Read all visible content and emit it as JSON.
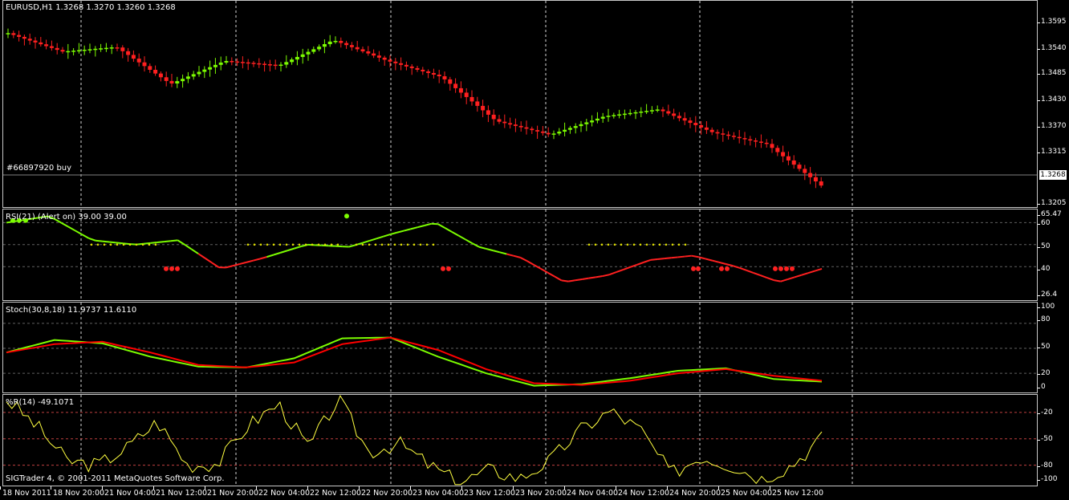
{
  "price_pane": {
    "header": "EURUSD,H1  1.3268 1.3270 1.3260 1.3268",
    "order_label": "#66897920 buy",
    "current_price": "1.3268",
    "axis_ticks": [
      "1.3595",
      "1.3540",
      "1.3485",
      "1.3430",
      "1.3370",
      "1.3315",
      "1.3260",
      "1.3205"
    ]
  },
  "rsi_pane": {
    "header": "RSI(21) (Alert on) 39.00 39.00",
    "axis_ticks": [
      "65.47",
      "60",
      "50",
      "40",
      "26.4"
    ]
  },
  "stoch_pane": {
    "header": "Stoch(30,8,18) 11.9737 11.6110",
    "axis_ticks": [
      "100",
      "80",
      "50",
      "20",
      "0"
    ]
  },
  "wpr_pane": {
    "header": "%R(14) -49.1071",
    "copyright": "SIGTrader 4, © 2001-2011 MetaQuotes Software Corp.",
    "axis_ticks": [
      "-20",
      "-50",
      "-80",
      "-100"
    ]
  },
  "time_axis": [
    "18 Nov 2011",
    "18 Nov 20:00",
    "21 Nov 04:00",
    "21 Nov 12:00",
    "21 Nov 20:00",
    "22 Nov 04:00",
    "22 Nov 12:00",
    "22 Nov 20:00",
    "23 Nov 04:00",
    "23 Nov 12:00",
    "23 Nov 20:00",
    "24 Nov 04:00",
    "24 Nov 12:00",
    "24 Nov 20:00",
    "25 Nov 04:00",
    "25 Nov 12:00"
  ],
  "colors": {
    "bull": "#7cfc00",
    "bear": "#ff2020",
    "signal": "#ff0000",
    "grid": "#ffffff",
    "level": "#c04040",
    "wpr": "#ffff40",
    "dots": "#e0e000"
  },
  "chart_data": [
    {
      "type": "line",
      "name": "price",
      "title": "EURUSD,H1",
      "x": [
        "18 Nov 2011",
        "18 Nov 20:00",
        "21 Nov 04:00",
        "21 Nov 12:00",
        "21 Nov 20:00",
        "22 Nov 04:00",
        "22 Nov 12:00",
        "22 Nov 20:00",
        "23 Nov 04:00",
        "23 Nov 12:00",
        "23 Nov 20:00",
        "24 Nov 04:00",
        "24 Nov 12:00",
        "24 Nov 20:00",
        "25 Nov 04:00",
        "25 Nov 12:00"
      ],
      "series": [
        {
          "values": [
            1.356,
            1.352,
            1.353,
            1.345,
            1.35,
            1.349,
            1.3545,
            1.35,
            1.3465,
            1.337,
            1.334,
            1.338,
            1.3395,
            1.3345,
            1.332,
            1.323
          ]
        }
      ],
      "ylim": [
        1.318,
        1.363
      ]
    },
    {
      "type": "line",
      "name": "rsi",
      "title": "RSI(21) (Alert on) 39.00 39.00",
      "series": [
        {
          "values": [
            60,
            63,
            52,
            50,
            52,
            39,
            44,
            50,
            49,
            55,
            60,
            49,
            44,
            33,
            36,
            43,
            45,
            40,
            33,
            39
          ]
        }
      ],
      "ylim": [
        24,
        66
      ]
    },
    {
      "type": "line",
      "name": "stoch",
      "title": "Stoch(30,8,18) 11.9737 11.6110",
      "series": [
        {
          "values": [
            45,
            60,
            56,
            40,
            28,
            27,
            38,
            62,
            63,
            40,
            20,
            5,
            7,
            14,
            23,
            26,
            13,
            10
          ]
        },
        {
          "values": [
            45,
            55,
            58,
            45,
            30,
            27,
            33,
            55,
            63,
            48,
            25,
            8,
            6,
            11,
            20,
            25,
            17,
            11
          ]
        }
      ],
      "ylim": [
        -5,
        105
      ]
    },
    {
      "type": "line",
      "name": "wpr",
      "title": "%R(14) -49.1071",
      "series": [
        {
          "values": [
            -5,
            -35,
            -75,
            -80,
            -60,
            -30,
            -80,
            -78,
            -35,
            -10,
            -60,
            -5,
            -65,
            -55,
            -80,
            -100,
            -85,
            -95,
            -75,
            -40,
            -18,
            -40,
            -90,
            -70,
            -80,
            -95,
            -80,
            -49
          ]
        }
      ],
      "ylim": [
        -105,
        0
      ]
    }
  ]
}
